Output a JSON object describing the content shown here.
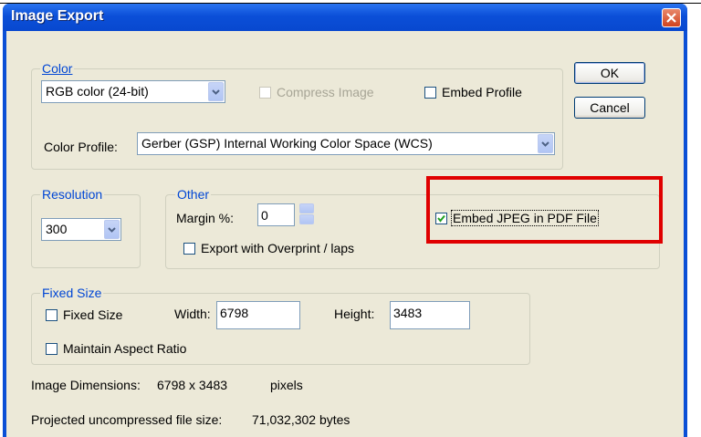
{
  "window": {
    "title": "Image Export",
    "accent": "#0a4fd6",
    "close_icon": "close-icon"
  },
  "color_group": {
    "legend": "Color",
    "color_mode": {
      "selected": "RGB color (24-bit)"
    },
    "compress_image": {
      "label": "Compress Image",
      "checked": false,
      "enabled": false
    },
    "embed_profile": {
      "label": "Embed Profile",
      "checked": false
    },
    "color_profile_label": "Color Profile:",
    "color_profile": {
      "selected": "Gerber (GSP) Internal Working Color Space (WCS)"
    }
  },
  "buttons": {
    "ok": "OK",
    "cancel": "Cancel"
  },
  "resolution_group": {
    "legend": "Resolution",
    "selected": "300"
  },
  "other_group": {
    "legend": "Other",
    "margin_label": "Margin %:",
    "margin_value": "0",
    "export_overprint": {
      "label": "Export with Overprint / laps",
      "checked": false
    },
    "embed_jpeg": {
      "label": "Embed JPEG in PDF File",
      "checked": true
    }
  },
  "fixed_size_group": {
    "legend": "Fixed Size",
    "fixed_size": {
      "label": "Fixed Size",
      "checked": false
    },
    "width_label": "Width:",
    "width_value": "6798",
    "height_label": "Height:",
    "height_value": "3483",
    "maintain_aspect": {
      "label": "Maintain Aspect Ratio",
      "checked": false
    }
  },
  "info": {
    "dimensions_label": "Image Dimensions:",
    "dimensions_value": "6798 x 3483",
    "dimensions_unit": "pixels",
    "filesize_label": "Projected uncompressed file size:",
    "filesize_value": "71,032,302 bytes"
  },
  "highlight_color": "#e00000"
}
